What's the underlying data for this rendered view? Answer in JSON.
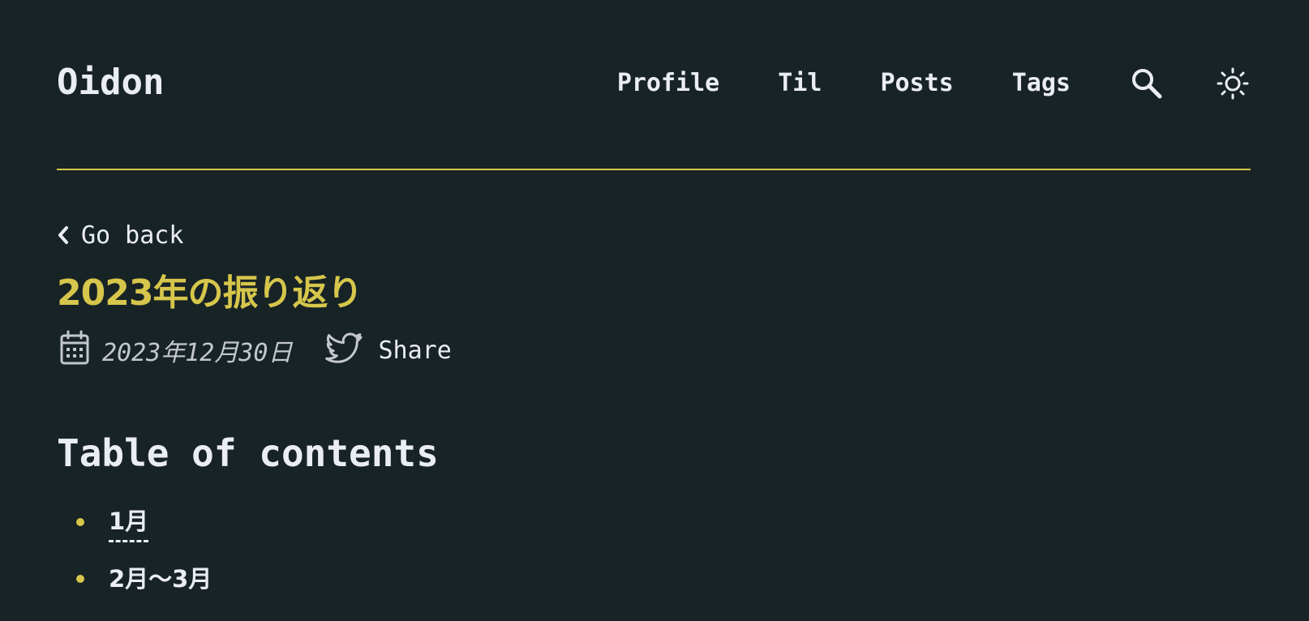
{
  "header": {
    "logo": "Oidon",
    "nav": [
      {
        "label": "Profile"
      },
      {
        "label": "Til"
      },
      {
        "label": "Posts"
      },
      {
        "label": "Tags"
      }
    ],
    "icons": {
      "search": "search-icon",
      "theme": "sun-icon"
    }
  },
  "post": {
    "go_back": "Go back",
    "title": "2023年の振り返り",
    "date": "2023年12月30日",
    "share": "Share"
  },
  "toc": {
    "heading": "Table of contents",
    "items": [
      {
        "label": "1月"
      },
      {
        "label": "2月〜3月"
      }
    ]
  },
  "colors": {
    "background": "#182326",
    "accent": "#d6c64b",
    "text": "#eaedf3"
  }
}
